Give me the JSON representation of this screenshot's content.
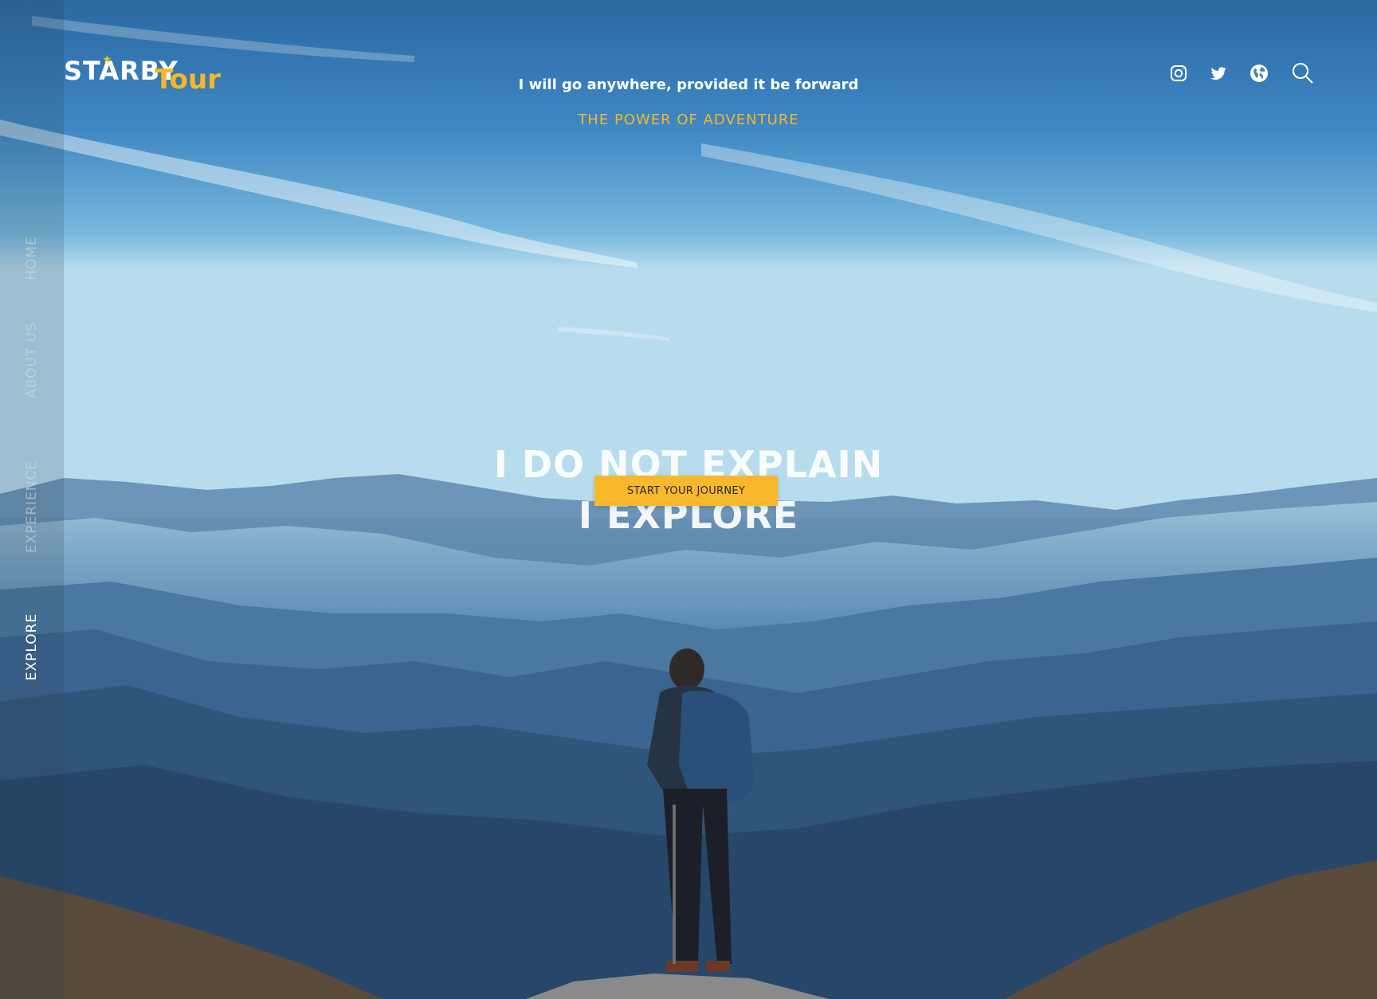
{
  "brand": {
    "name": "STARBY",
    "sub": "Tour"
  },
  "hero": {
    "tagline": "I will go anywhere, provided it be forward",
    "subtagline": "THE POWER OF ADVENTURE",
    "headline_1": "I DO NOT EXPLAIN",
    "headline_2": "I EXPLORE",
    "cta_label": "START YOUR JOURNEY"
  },
  "sidebar": {
    "items": [
      {
        "label": "HOME",
        "active": false
      },
      {
        "label": "ABOUT US",
        "active": false
      },
      {
        "label": "EXPERIENCE",
        "active": false
      },
      {
        "label": "EXPLORE",
        "active": true
      }
    ]
  },
  "social": {
    "icons": [
      "instagram-icon",
      "twitter-icon",
      "globe-icon",
      "search-icon"
    ]
  },
  "colors": {
    "accent": "#f6b729",
    "text_primary": "#ffffff",
    "sidebar_inactive": "#a9b6c2"
  }
}
